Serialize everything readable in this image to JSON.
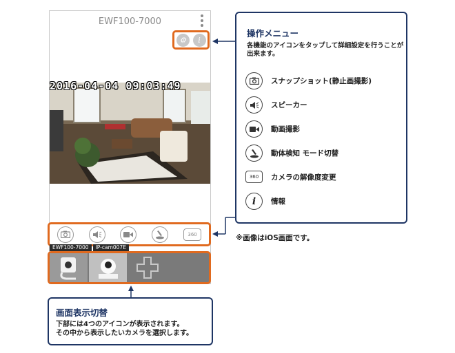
{
  "phone": {
    "title": "EWF100-7000",
    "timestamp": "2016-04-04 09:03:49",
    "camera_tabs": [
      "EWF100-7000",
      "IP-cam007E"
    ]
  },
  "menu_panel": {
    "title": "操作メニュー",
    "description": "各機能のアイコンをタップして詳細設定を行うことが出来ます。",
    "features": [
      {
        "icon": "camera-icon",
        "label": "スナップショット(静止画撮影)"
      },
      {
        "icon": "speaker-icon",
        "label": "スピーカー"
      },
      {
        "icon": "video-icon",
        "label": "動画撮影"
      },
      {
        "icon": "motion-detect-icon",
        "label": "動体検知 モード切替"
      },
      {
        "icon": "resolution-icon",
        "label": "カメラの解像度変更"
      },
      {
        "icon": "info-icon",
        "label": "情報"
      }
    ]
  },
  "note": "※画像はiOS画面です。",
  "switch_panel": {
    "title": "画面表示切替",
    "line1": "下部には4つのアイコンが表示されます。",
    "line2": "その中から表示したいカメラを選択します。"
  },
  "colors": {
    "accent": "#e06a1f",
    "navy": "#1e3564"
  }
}
